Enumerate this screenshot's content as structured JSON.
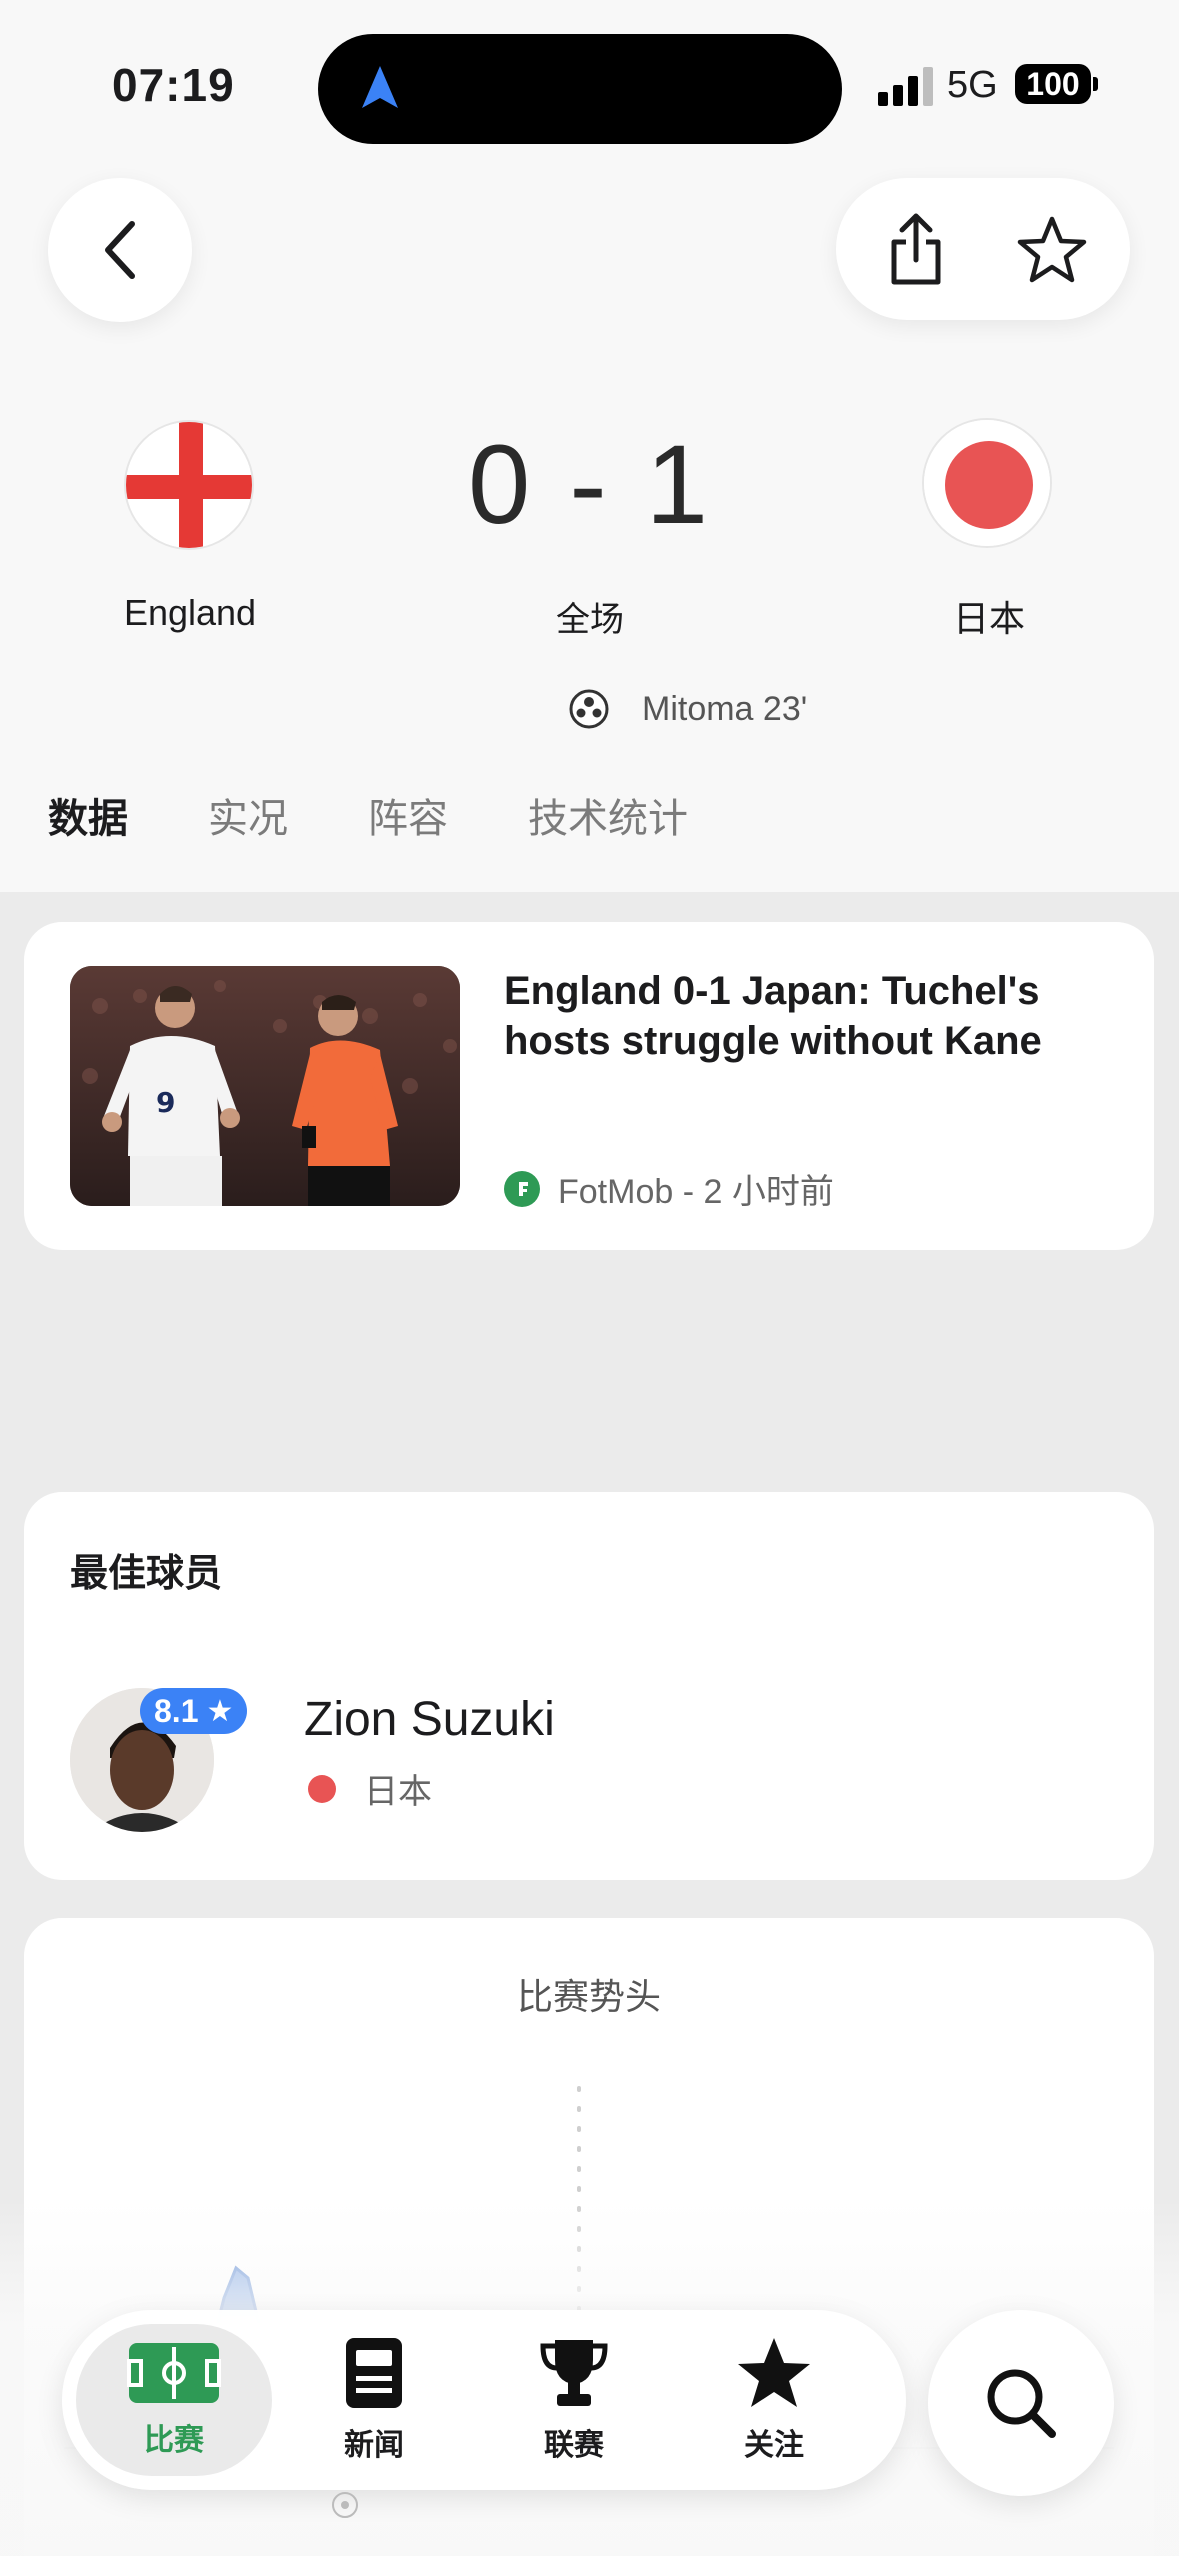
{
  "status_bar": {
    "time": "07:19",
    "network": "5G",
    "battery": "100"
  },
  "nav": {
    "back_icon": "chevron-left-icon",
    "share_icon": "share-icon",
    "favorite_icon": "star-icon"
  },
  "match": {
    "home_team": "England",
    "away_team": "日本",
    "score": "0 - 1",
    "status": "全场",
    "goals": [
      {
        "text": "Mitoma 23'"
      }
    ]
  },
  "tabs": [
    "数据",
    "实况",
    "阵容",
    "技术统计"
  ],
  "news": {
    "title": "England 0-1 Japan: Tuchel's hosts struggle without Kane",
    "source": "FotMob - 2 小时前"
  },
  "player_of_match": {
    "section_title": "最佳球员",
    "rating": "8.1",
    "name": "Zion Suzuki",
    "team": "日本"
  },
  "momentum": {
    "title": "比赛势头"
  },
  "tabbar": {
    "items": [
      {
        "label": "比赛",
        "icon": "pitch-icon",
        "active": true
      },
      {
        "label": "新闻",
        "icon": "news-icon",
        "active": false
      },
      {
        "label": "联赛",
        "icon": "trophy-icon",
        "active": false
      },
      {
        "label": "关注",
        "icon": "star-icon",
        "active": false
      }
    ],
    "search_icon": "search-icon"
  },
  "colors": {
    "accent_green": "#2e9a55",
    "rating_blue": "#3b82f6",
    "japan_red": "#e85454",
    "england_red": "#e53935",
    "momentum_blue": "#7ea6e0"
  }
}
